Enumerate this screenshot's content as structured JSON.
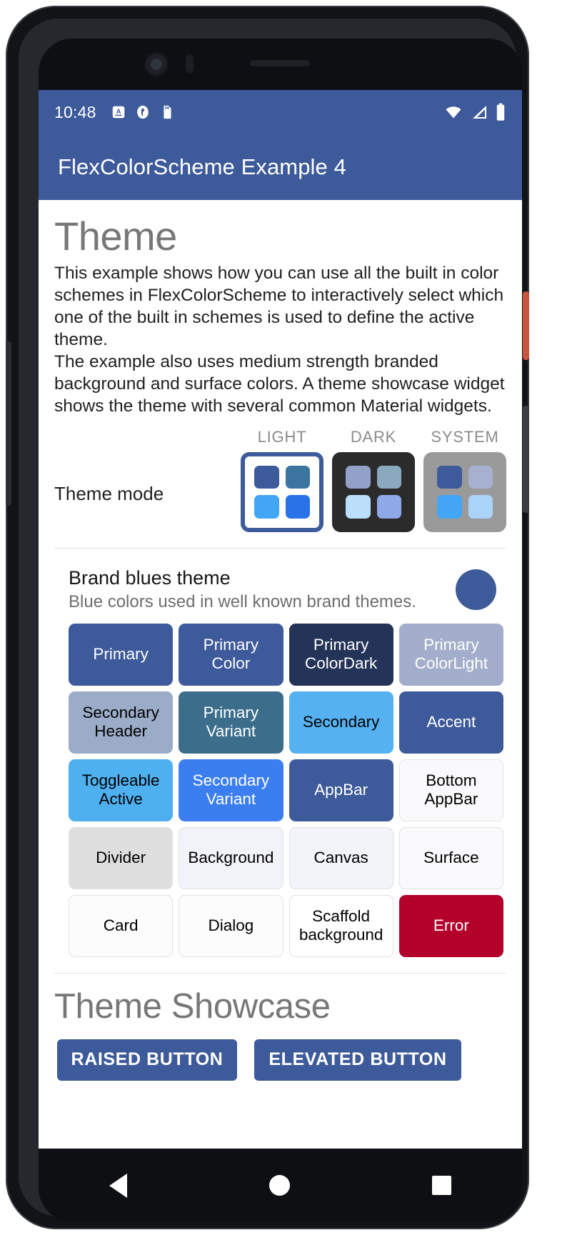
{
  "statusbar": {
    "time": "10:48",
    "icons_left": [
      "alarm-icon",
      "do-not-disturb-icon",
      "sd-card-icon"
    ],
    "icons_right": [
      "wifi-icon",
      "cellular-signal-icon",
      "battery-icon"
    ]
  },
  "appbar": {
    "title": "FlexColorScheme Example 4",
    "background": "#3d5a9a"
  },
  "page": {
    "headline": "Theme",
    "paragraph1": "This example shows how you can use all the built in color schemes in FlexColorScheme to interactively select which one of the built in schemes is used to define the active theme.",
    "paragraph2": "The example also uses medium strength branded background and surface colors. A theme showcase widget shows the theme with several common Material widgets."
  },
  "theme_mode": {
    "label": "Theme mode",
    "options": [
      {
        "caption": "LIGHT",
        "selected": true,
        "frame": "#3d5a9a",
        "fill": "#ffffff",
        "squares": [
          "#3d5a9a",
          "#3c74a0",
          "#42a5f5",
          "#2a72e8"
        ]
      },
      {
        "caption": "DARK",
        "selected": false,
        "frame": "#2b2b2b",
        "fill": "#2b2b2b",
        "squares": [
          "#92a1c8",
          "#8aa9bf",
          "#bbdefb",
          "#8fa8e8"
        ]
      },
      {
        "caption": "SYSTEM",
        "selected": false,
        "frame": "#9a9a9a",
        "fill": "#9a9a9a",
        "squares": [
          "#3d5a9a",
          "#a5b1ce",
          "#42a5f5",
          "#a9d4f7"
        ]
      }
    ]
  },
  "scheme": {
    "title": "Brand blues theme",
    "subtitle": "Blue colors used in well known brand themes.",
    "dot_color": "#3d5a9a"
  },
  "color_swatches": [
    {
      "label": "Primary",
      "bg": "#3d5a9a",
      "fg": "#ffffff",
      "bordered": false
    },
    {
      "label": "Primary\nColor",
      "bg": "#3d5a9a",
      "fg": "#ffffff",
      "bordered": false
    },
    {
      "label": "Primary\nColorDark",
      "bg": "#243358",
      "fg": "#ffffff",
      "bordered": false
    },
    {
      "label": "Primary\nColorLight",
      "bg": "#a2aecb",
      "fg": "#ffffff",
      "bordered": false
    },
    {
      "label": "Secondary\nHeader",
      "bg": "#9bacc8",
      "fg": "#000000",
      "bordered": false
    },
    {
      "label": "Primary\nVariant",
      "bg": "#3c6e8c",
      "fg": "#ffffff",
      "bordered": false
    },
    {
      "label": "Secondary",
      "bg": "#55b1f0",
      "fg": "#000000",
      "bordered": false
    },
    {
      "label": "Accent",
      "bg": "#3d5a9a",
      "fg": "#ffffff",
      "bordered": false
    },
    {
      "label": "Toggleable\nActive",
      "bg": "#4fb0f0",
      "fg": "#000000",
      "bordered": false
    },
    {
      "label": "Secondary\nVariant",
      "bg": "#3b7ef0",
      "fg": "#ffffff",
      "bordered": false
    },
    {
      "label": "AppBar",
      "bg": "#3d5a9a",
      "fg": "#ffffff",
      "bordered": false
    },
    {
      "label": "Bottom\nAppBar",
      "bg": "#fafafc",
      "fg": "#000000",
      "bordered": true
    },
    {
      "label": "Divider",
      "bg": "#dedede",
      "fg": "#000000",
      "bordered": true
    },
    {
      "label": "Background",
      "bg": "#f2f3f8",
      "fg": "#000000",
      "bordered": true
    },
    {
      "label": "Canvas",
      "bg": "#f2f4f9",
      "fg": "#000000",
      "bordered": true
    },
    {
      "label": "Surface",
      "bg": "#fafafc",
      "fg": "#000000",
      "bordered": true
    },
    {
      "label": "Card",
      "bg": "#fcfcfd",
      "fg": "#000000",
      "bordered": true
    },
    {
      "label": "Dialog",
      "bg": "#fcfcfd",
      "fg": "#000000",
      "bordered": true
    },
    {
      "label": "Scaffold\nbackground",
      "bg": "#ffffff",
      "fg": "#000000",
      "bordered": true
    },
    {
      "label": "Error",
      "bg": "#b3012c",
      "fg": "#ffffff",
      "bordered": false
    }
  ],
  "showcase": {
    "title": "Theme Showcase",
    "buttons": [
      {
        "label": "RAISED BUTTON",
        "bg": "#3d5a9a",
        "fg": "#ffffff"
      },
      {
        "label": "ELEVATED BUTTON",
        "bg": "#3d5a9a",
        "fg": "#ffffff"
      }
    ]
  },
  "navbar": {
    "items": [
      "back-nav-icon",
      "home-nav-icon",
      "recents-nav-icon"
    ]
  }
}
